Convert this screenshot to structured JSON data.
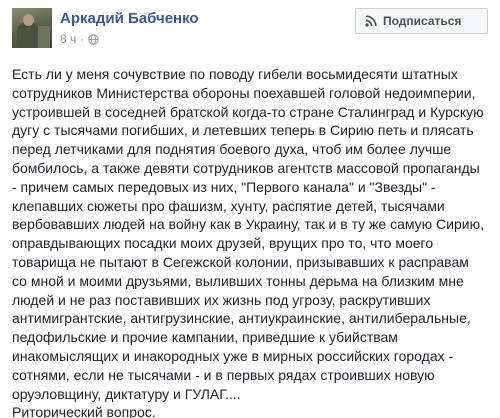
{
  "post": {
    "author": "Аркадий Бабченко",
    "timestamp": "8 ч",
    "separator": "·",
    "privacy_icon": "globe-icon",
    "subscribe_icon": "rss-icon",
    "subscribe_label": "Подписаться",
    "text_lines": [
      "Есть ли у меня сочувствие по поводу гибели восьмидесяти штатных",
      "сотрудников Министерства обороны поехавшей головой недоимперии,",
      "устроившей в соседней братской когда-то стране Сталинград и Курскую",
      "дугу с тысячами погибших, и летевших теперь в Сирию петь и плясать",
      "перед летчиками для поднятия боевого духа, чтоб им более лучше",
      "бомбилось, а также девяти сотрудников агентств массовой пропаганды",
      "- причем самых передовых из них, \"Первого канала\" и \"Звезды\" -",
      "клепавших сюжеты про фашизм, хунту, распятие детей, тысячами",
      "вербовавших людей на войну как в Украину, так и в ту же самую Сирию,",
      "оправдывающих посадки моих друзей, врущих про то, что моего",
      "товарища не пытают в Сегежской колонии, призывавших к расправам",
      "со мной и моими друзьями, выливших тонны дерьма на близким мне",
      "людей и не раз поставивших их жизнь под угрозу, раскрутивших",
      "антимигрантские, антигрузинские, антиукраинские, антилиберальные,",
      "педофильские и прочие кампании, приведшие к убийствам",
      "инакомыслящих и инакородных уже в мирных российских городах -",
      "сотнями, если не тысячами - и в первых рядах строивших новую",
      "оруэловщину, диктатуру и ГУЛАГ....",
      "Риторический вопрос."
    ]
  },
  "colors": {
    "author_link": "#365899",
    "meta_text": "#90949c",
    "body_text": "#1d2129",
    "button_bg": "#f6f7f9",
    "button_border": "#ced0d4"
  }
}
